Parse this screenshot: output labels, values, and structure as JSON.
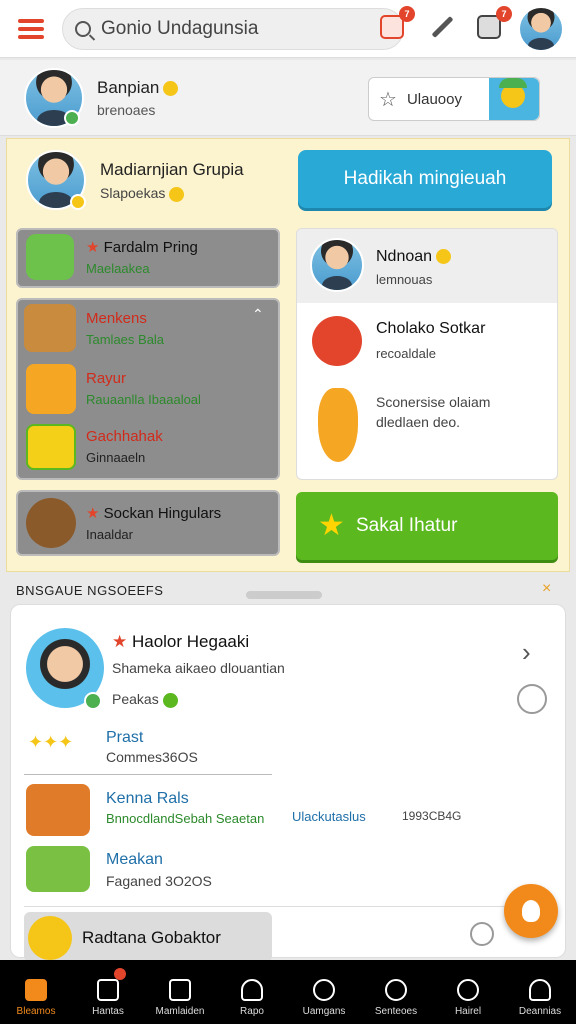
{
  "topbar": {
    "search_text": "Gonio Undagunsia",
    "notification_badge": "7",
    "mail_badge": "7"
  },
  "profile": {
    "name": "Banpian",
    "subtitle": "brenoaes",
    "favorite_label": "Ulauooy"
  },
  "group": {
    "title": "Madiarnjian Grupia",
    "subtitle": "Slapoekas",
    "primary_button": "Hadikah mingieuah"
  },
  "left_cards": [
    {
      "title": "Fardalm Pring",
      "subtitle": "Maelaakea"
    },
    {
      "title": "Menkens",
      "subtitle": "Tamlaes Bala"
    },
    {
      "title": "Rayur",
      "subtitle": "Rauaanlla Ibaaaloal"
    },
    {
      "title": "Gachhahak",
      "subtitle": "Ginnaaeln"
    },
    {
      "title": "Sockan Hingulars",
      "subtitle": "Inaaldar"
    }
  ],
  "right_card": {
    "header_title": "Ndnoan",
    "header_sub": "lemnouas",
    "item1_title": "Cholako Sotkar",
    "item1_sub": "recoaldale",
    "item2_text": "Sconersise olaiam dledlaen deo."
  },
  "green_button": "Sakal Ihatur",
  "section": {
    "label": "BNSGAUE NGSOEEFS",
    "close": "×"
  },
  "list": {
    "main_title": "Haolor Hegaaki",
    "main_sub": "Shameka aikaeo dlouantian",
    "main_tag": "Peakas",
    "rows": [
      {
        "title": "Prast",
        "sub": "Commes36OS"
      },
      {
        "title": "Kenna Rals",
        "sub": "BnnocdlandSebah Seaetan",
        "extra": "Ulackutaslus",
        "code": "1993CB4G"
      },
      {
        "title": "Meakan",
        "sub": "Faganed 3O2OS"
      }
    ],
    "bottom_title": "Radtana Gobaktor"
  },
  "nav": [
    {
      "label": "Bleamos",
      "icon": "home-icon"
    },
    {
      "label": "Hantas",
      "icon": "store-icon"
    },
    {
      "label": "Mamlaiden",
      "icon": "screen-icon"
    },
    {
      "label": "Rapo",
      "icon": "shield-icon"
    },
    {
      "label": "Uamgans",
      "icon": "search-icon"
    },
    {
      "label": "Senteoes",
      "icon": "search-icon"
    },
    {
      "label": "Hairel",
      "icon": "clock-icon"
    },
    {
      "label": "Deannias",
      "icon": "user-icon"
    }
  ],
  "colors": {
    "accent": "#f28a1b",
    "primary_blue": "#29a9d6",
    "green": "#5bb81f",
    "red": "#e2452b",
    "panel_yellow": "#fcf3cf"
  }
}
